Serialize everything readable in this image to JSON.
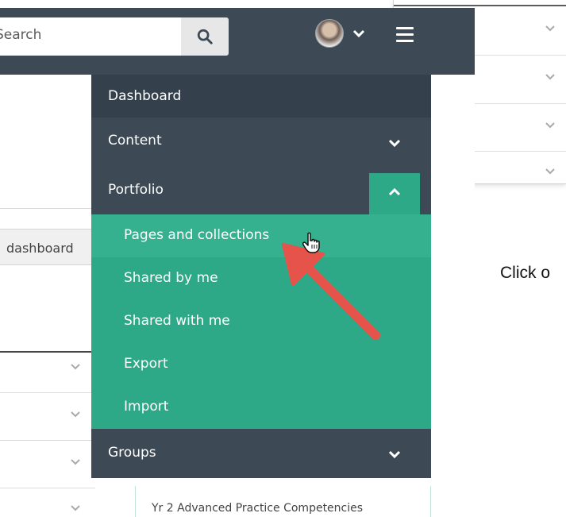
{
  "search": {
    "placeholder": "Search",
    "value": ""
  },
  "icons": {
    "search": "search-icon",
    "avatar_caret": "chevron-down-icon",
    "menu": "hamburger-icon",
    "cursor": "hand-pointer-icon"
  },
  "colors": {
    "topbar": "#3d4a55",
    "nav_dark": "#34414c",
    "accent_green": "#2ea987",
    "active_green": "#35b18f",
    "arrow_red": "#e5534b"
  },
  "nav": {
    "dashboard": "Dashboard",
    "content": "Content",
    "portfolio": "Portfolio",
    "portfolio_items": [
      "Pages and collections",
      "Shared by me",
      "Shared with me",
      "Export",
      "Import"
    ],
    "groups": "Groups"
  },
  "left": {
    "dashboard_tab": "dashboard"
  },
  "card": {
    "title": "Yr 2 Advanced Practice Competencies"
  },
  "side_text": "Click o"
}
